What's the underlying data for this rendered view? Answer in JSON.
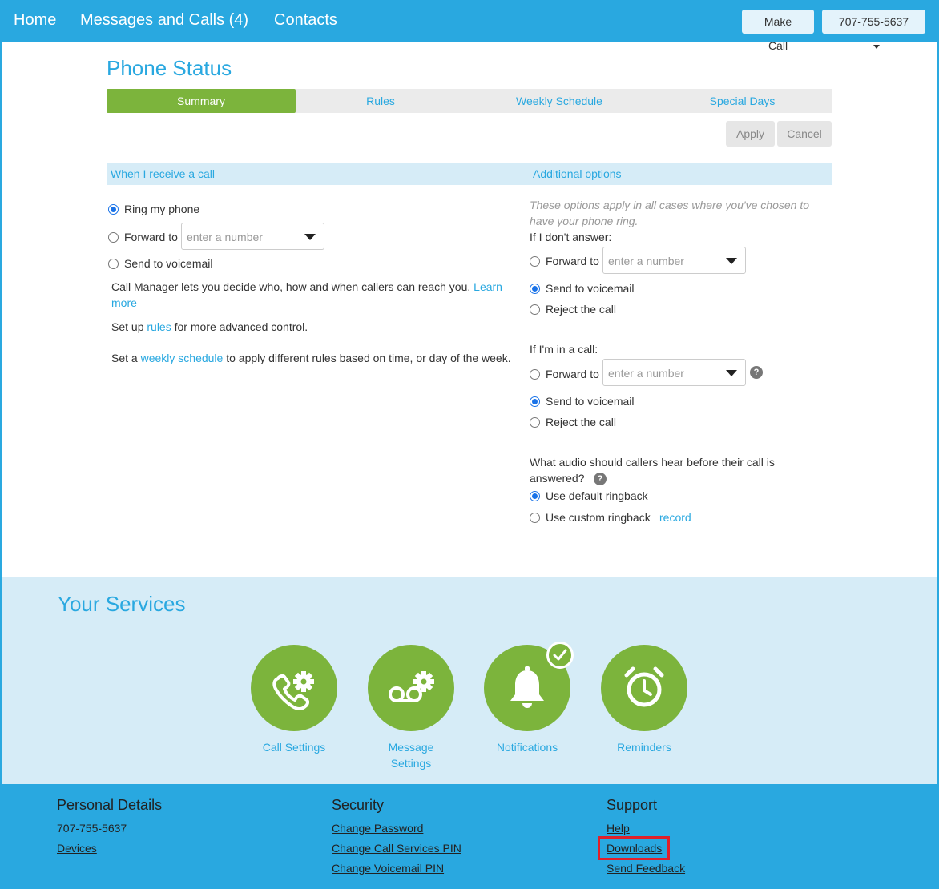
{
  "nav": {
    "home": "Home",
    "messages": "Messages and Calls (4)",
    "contacts": "Contacts",
    "make_call": "Make Call",
    "phone_number": "707-755-5637"
  },
  "page": {
    "title": "Phone Status",
    "tabs": [
      "Summary",
      "Rules",
      "Weekly Schedule",
      "Special Days"
    ],
    "active_tab": "Summary",
    "apply": "Apply",
    "cancel": "Cancel"
  },
  "receive": {
    "header": "When I receive a call",
    "ring_my_phone": "Ring my phone",
    "forward_to": "Forward to",
    "forward_placeholder": "enter a number",
    "send_to_voicemail": "Send to voicemail",
    "selected": "Ring my phone",
    "info_text": "Call Manager lets you decide who, how and when callers can reach you.",
    "learn": "Learn",
    "more": "more",
    "rules_prefix": "Set up",
    "rules_link": "rules",
    "rules_suffix": "for more advanced control.",
    "schedule_prefix": "Set a",
    "schedule_link": "weekly schedule",
    "schedule_suffix": "to apply different rules based on time, or day of the week."
  },
  "additional": {
    "header": "Additional options",
    "note_line1": "These options apply in all cases where you've chosen to",
    "note_line2": "have your phone ring.",
    "no_answer": {
      "label": "If I don't answer:",
      "forward_to": "Forward to",
      "placeholder": "enter a number",
      "voicemail": "Send to voicemail",
      "reject": "Reject the call",
      "selected": "Send to voicemail"
    },
    "in_call": {
      "label": "If I'm in a call:",
      "forward_to": "Forward to",
      "placeholder": "enter a number",
      "voicemail": "Send to voicemail",
      "reject": "Reject the call",
      "selected": "Send to voicemail"
    },
    "audio_q_line1": "What audio should callers hear before their call is",
    "audio_q_line2": "answered?",
    "default_ringback": "Use default ringback",
    "custom_ringback": "Use custom ringback",
    "record": "record",
    "selected_ringback": "Use default ringback"
  },
  "services": {
    "title": "Your Services",
    "items": [
      {
        "label1": "Call Settings",
        "label2": "",
        "icon": "phone-gear-icon"
      },
      {
        "label1": "Message",
        "label2": "Settings",
        "icon": "voicemail-gear-icon"
      },
      {
        "label1": "Notifications",
        "label2": "",
        "icon": "bell-icon",
        "enabled": true
      },
      {
        "label1": "Reminders",
        "label2": "",
        "icon": "alarm-clock-icon"
      }
    ]
  },
  "footer": {
    "personal": {
      "title": "Personal Details",
      "phone": "707-755-5637",
      "devices": "Devices"
    },
    "security": {
      "title": "Security",
      "change_password": "Change Password",
      "change_call_pin": "Change Call Services PIN",
      "change_voicemail_pin": "Change Voicemail PIN"
    },
    "support": {
      "title": "Support",
      "help": "Help",
      "downloads": "Downloads",
      "send_feedback": "Send Feedback"
    }
  },
  "colors": {
    "brand_blue": "#29a8e0",
    "accent_green": "#7cb43c",
    "light_blue": "#d6ecf7",
    "highlight_red": "#e0202a"
  }
}
